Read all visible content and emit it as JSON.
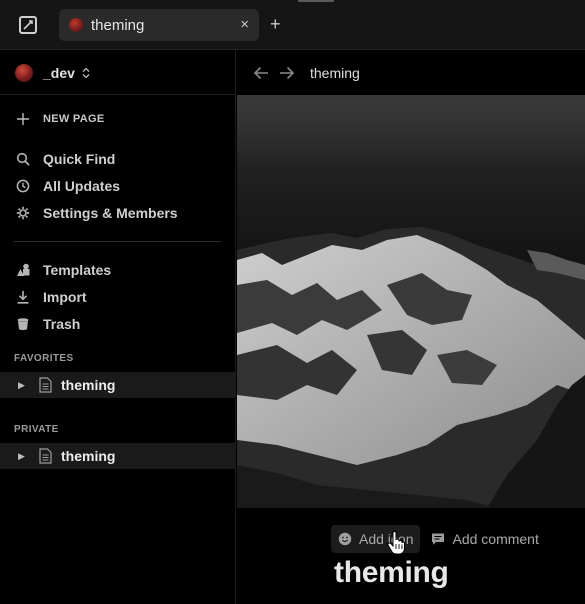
{
  "titlebar": {
    "tab": {
      "title": "theming",
      "close_glyph": "×"
    },
    "new_tab_glyph": "+"
  },
  "sidebar": {
    "workspace": {
      "name": "_dev"
    },
    "new_page_label": "NEW PAGE",
    "nav": [
      {
        "label": "Quick Find",
        "icon": "search-icon"
      },
      {
        "label": "All Updates",
        "icon": "clock-icon"
      },
      {
        "label": "Settings & Members",
        "icon": "gear-icon"
      }
    ],
    "tools": [
      {
        "label": "Templates",
        "icon": "shapes-icon"
      },
      {
        "label": "Import",
        "icon": "download-icon"
      },
      {
        "label": "Trash",
        "icon": "trash-icon"
      }
    ],
    "favorites": {
      "heading": "FAVORITES",
      "pages": [
        {
          "title": "theming"
        }
      ]
    },
    "private": {
      "heading": "PRIVATE",
      "pages": [
        {
          "title": "theming"
        }
      ]
    }
  },
  "main": {
    "breadcrumb": "theming",
    "actions": {
      "add_icon": "Add icon",
      "add_comment": "Add comment"
    },
    "page_title": "theming"
  },
  "colors": {
    "background": "#000000",
    "titlebar": "#151515",
    "tab_active": "#2a2a2a",
    "selected_row": "#1a1a1a",
    "text": "#e8e8e8",
    "muted": "#9a9a9a"
  }
}
